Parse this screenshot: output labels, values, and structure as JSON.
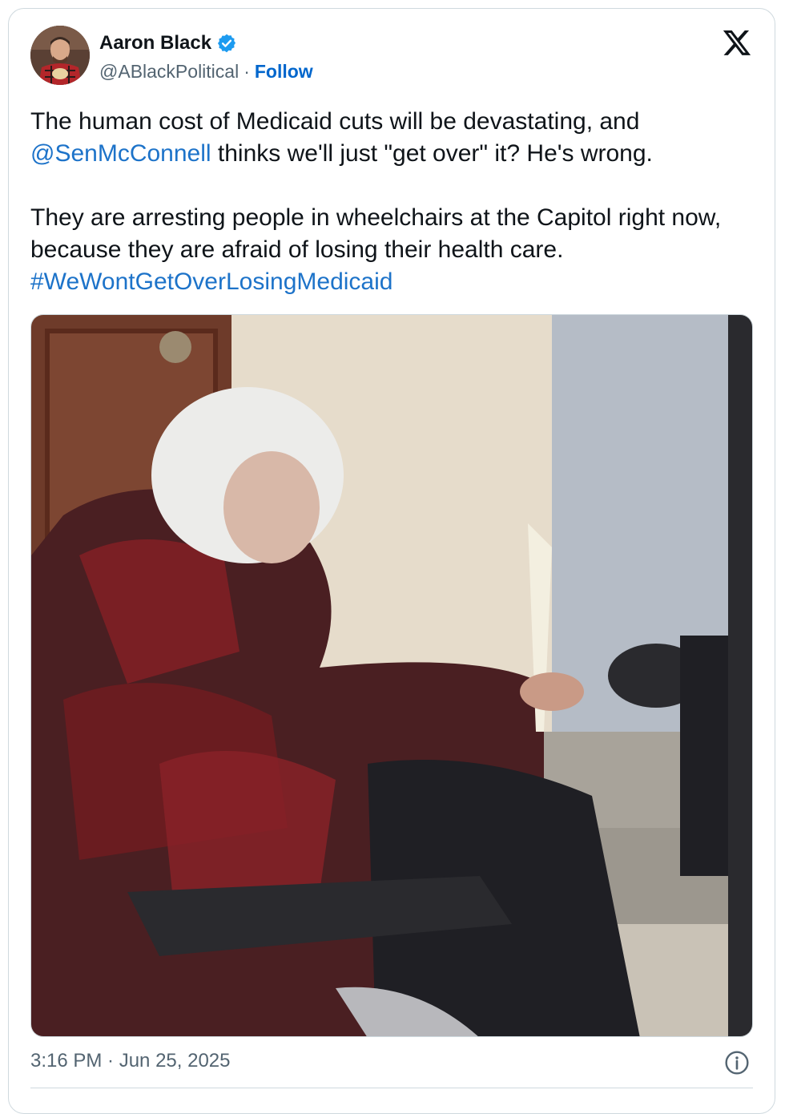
{
  "tweet": {
    "author_name": "Aaron Black",
    "handle": "@ABlackPolitical",
    "separator": "·",
    "follow_label": "Follow",
    "paragraph1_pre": "The human cost of Medicaid cuts will be devastating, and ",
    "mention": "@SenMcConnell",
    "paragraph1_post": " thinks we'll just \"get over\" it? He's wrong.",
    "paragraph2": "They are arresting people in wheelchairs at the Capitol right now, because they are afraid of losing their health care.",
    "hashtag": "#WeWontGetOverLosingMedicaid",
    "timestamp": "3:16 PM · Jun 25, 2025"
  },
  "icons": {
    "verified": "verified-badge-icon",
    "brand": "x-logo-icon",
    "info": "info-icon"
  },
  "colors": {
    "link": "#1d73c9",
    "follow": "#0066cc",
    "verified": "#1d9bf0",
    "secondary_text": "#536471"
  }
}
